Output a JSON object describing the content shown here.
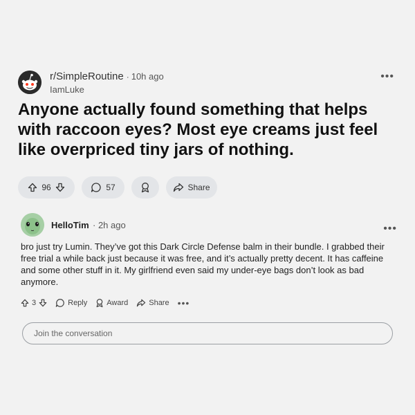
{
  "post": {
    "subreddit": "r/SimpleRoutine",
    "separator": "·",
    "time": "10h ago",
    "username": "IamLuke",
    "title": "Anyone actually found something that helps with raccoon eyes? Most eye creams just feel like overpriced tiny jars of nothing.",
    "more": "•••",
    "votes": "96",
    "comments": "57",
    "share_label": "Share"
  },
  "comment": {
    "author": "HelloTim",
    "time": "· 2h ago",
    "more": "•••",
    "body": "bro just try Lumin. They’ve got this Dark Circle Defense balm in their bundle. I grabbed their free trial a while back just because it was free, and it’s actually pretty decent. It has caffeine and some other stuff in it. My girlfriend even said my under-eye bags don’t look as bad anymore.",
    "votes": "3",
    "reply_label": "Reply",
    "award_label": "Award",
    "share_label": "Share",
    "more_actions": "•••"
  },
  "join": {
    "placeholder": "Join the conversation"
  },
  "icons": {
    "upvote": "arrow-up-icon",
    "downvote": "arrow-down-icon",
    "comment": "speech-bubble-icon",
    "award": "award-icon",
    "share": "share-arrow-icon"
  }
}
